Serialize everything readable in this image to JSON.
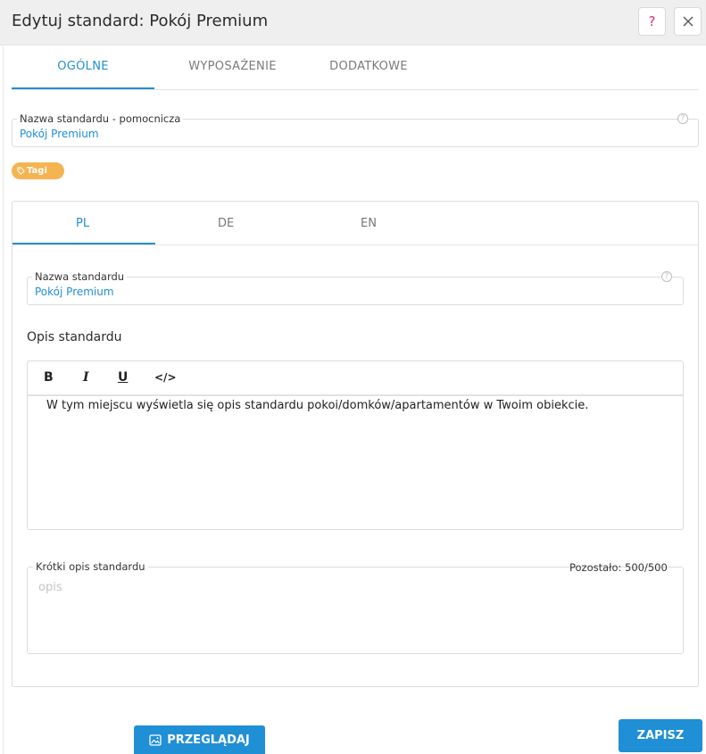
{
  "dialog": {
    "title": "Edytuj standard: Pokój Premium",
    "help_label": "?",
    "close_icon": "close-icon"
  },
  "tabs": [
    {
      "label": "OGÓLNE",
      "active": true
    },
    {
      "label": "WYPOSAŻENIE",
      "active": false
    },
    {
      "label": "DODATKOWE",
      "active": false
    }
  ],
  "helper_name": {
    "label": "Nazwa standardu - pomocnicza",
    "value": "Pokój Premium",
    "help_icon": "question-circle-icon"
  },
  "tag": {
    "label": "Tagi",
    "icon": "tag-icon",
    "color": "#f5b452"
  },
  "language_tabs": [
    {
      "label": "PL",
      "active": true
    },
    {
      "label": "DE",
      "active": false
    },
    {
      "label": "EN",
      "active": false
    }
  ],
  "standard_name": {
    "label": "Nazwa standardu",
    "value": "Pokój Premium",
    "help_icon": "question-circle-icon"
  },
  "description": {
    "label": "Opis standardu",
    "toolbar": {
      "bold": "B",
      "italic": "I",
      "underline": "U",
      "code": "</>"
    },
    "text": "W tym miejscu wyświetla się opis standardu pokoi/domków/apartamentów w Twoim obiekcie."
  },
  "short_description": {
    "label": "Krótki opis standardu",
    "remaining": "Pozostało: 500/500",
    "placeholder": "opis"
  },
  "buttons": {
    "browse_label": "PRZEGLĄDAJ",
    "browse_icon": "image-icon",
    "save_label": "ZAPISZ"
  },
  "colors": {
    "accent": "#1f8fd6",
    "tag": "#f5b452",
    "help": "#e0306c"
  }
}
